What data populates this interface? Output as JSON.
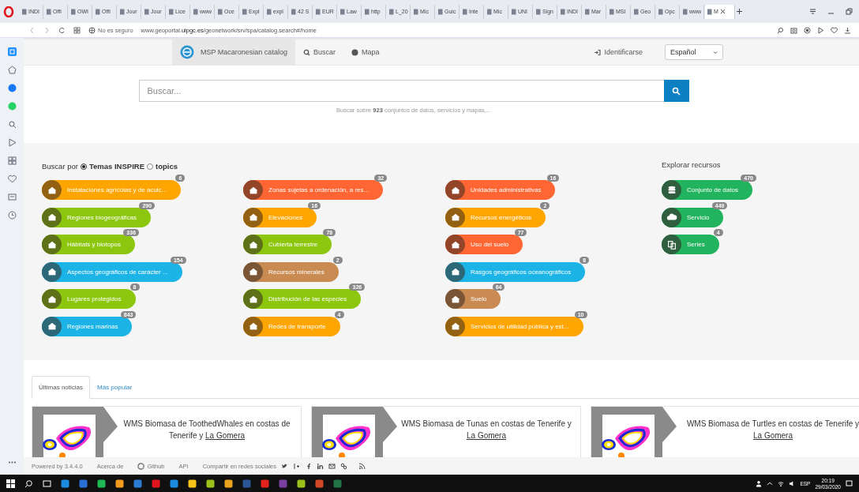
{
  "browser": {
    "tabs": [
      {
        "label": "INDI",
        "selected": false
      },
      {
        "label": "Offi",
        "selected": false
      },
      {
        "label": "OWI",
        "selected": false
      },
      {
        "label": "Offi",
        "selected": false
      },
      {
        "label": "Jour",
        "selected": false
      },
      {
        "label": "Jour",
        "selected": false
      },
      {
        "label": "Lice",
        "selected": false
      },
      {
        "label": "www",
        "selected": false
      },
      {
        "label": "Oce",
        "selected": false
      },
      {
        "label": "Expl",
        "selected": false
      },
      {
        "label": "expl",
        "selected": false
      },
      {
        "label": "42 S",
        "selected": false
      },
      {
        "label": "EUR",
        "selected": false
      },
      {
        "label": "Law",
        "selected": false
      },
      {
        "label": "http",
        "selected": false
      },
      {
        "label": "L_20",
        "selected": false
      },
      {
        "label": "Mic",
        "selected": false
      },
      {
        "label": "Guic",
        "selected": false
      },
      {
        "label": "Inte",
        "selected": false
      },
      {
        "label": "Mic",
        "selected": false
      },
      {
        "label": "UNI",
        "selected": false
      },
      {
        "label": "Sign",
        "selected": false
      },
      {
        "label": "INDI",
        "selected": false
      },
      {
        "label": "Mar",
        "selected": false
      },
      {
        "label": "MSI",
        "selected": false
      },
      {
        "label": "Geo",
        "selected": false
      },
      {
        "label": "Opc",
        "selected": false
      },
      {
        "label": "www",
        "selected": false
      },
      {
        "label": "M",
        "selected": true
      }
    ],
    "security": "No es seguro",
    "url": "www.geoportal.**ulpgc.es**/geonetwork/srv/spa/catalog.search#/home"
  },
  "nav": {
    "brand": "MSP Macaronesian catalog",
    "links": [
      "Buscar",
      "Mapa"
    ],
    "login": "Identificarse",
    "language": "Español"
  },
  "search": {
    "placeholder": "Buscar...",
    "hint": "Buscar sobre **923** conjuntos de datos, servicios y mapas,..."
  },
  "filter": {
    "label": "Buscar por",
    "options": [
      {
        "label": "Temas INSPIRE",
        "selected": true
      },
      {
        "label": "topics",
        "selected": false
      }
    ]
  },
  "themes": [
    {
      "label": "Instalaciones agrícolas y de acuic...",
      "count": "6",
      "color": "#ffa500"
    },
    {
      "label": "Regiones biogeográficas",
      "count": "290",
      "color": "#8cc70e"
    },
    {
      "label": "Hábitats y biotopos",
      "count": "336",
      "color": "#8cc70e"
    },
    {
      "label": "Aspectos geográficos de carácter ...",
      "count": "154",
      "color": "#1cb3e6"
    },
    {
      "label": "Lugares protegidos",
      "count": "8",
      "color": "#8cc70e"
    },
    {
      "label": "Regiones marinas",
      "count": "843",
      "color": "#1cb3e6"
    },
    {
      "label": "Zonas sujetas a ordenación, a res...",
      "count": "32",
      "color": "#ff6633"
    },
    {
      "label": "Elevaciones",
      "count": "16",
      "color": "#ffa500"
    },
    {
      "label": "Cubierta terrestre",
      "count": "78",
      "color": "#8cc70e"
    },
    {
      "label": "Recursos minerales",
      "count": "2",
      "color": "#c98b52"
    },
    {
      "label": "Distribución de las especies",
      "count": "326",
      "color": "#8cc70e"
    },
    {
      "label": "Redes de transporte",
      "count": "4",
      "color": "#ffa500"
    },
    {
      "label": "Unidades administrativas",
      "count": "16",
      "color": "#ff6633"
    },
    {
      "label": "Recursos energéticos",
      "count": "2",
      "color": "#ffa500"
    },
    {
      "label": "Uso del suelo",
      "count": "77",
      "color": "#ff6633"
    },
    {
      "label": "Rasgos geográficos oceanográficos",
      "count": "8",
      "color": "#1cb3e6"
    },
    {
      "label": "Suelo",
      "count": "64",
      "color": "#c98b52"
    },
    {
      "label": "Servicios de utilidad pública y est...",
      "count": "10",
      "color": "#ffa500"
    }
  ],
  "explore": {
    "title": "Explorar recursos",
    "items": [
      {
        "label": "Conjunto de datos",
        "count": "470"
      },
      {
        "label": "Servicio",
        "count": "449"
      },
      {
        "label": "Series",
        "count": "4"
      }
    ]
  },
  "news": {
    "tabs": [
      {
        "label": "Últimas noticias",
        "selected": true
      },
      {
        "label": "Más popular",
        "selected": false
      }
    ],
    "cards": [
      {
        "title": "WMS Biomasa de ToothedWhales en costas de Tenerife y",
        "link": "La Gomera"
      },
      {
        "title": "WMS Biomasa de Tunas en costas de Tenerife y",
        "link": "La Gomera"
      },
      {
        "title": "WMS Biomasa de Turtles en costas de Tenerife y",
        "link": "La Gomera"
      }
    ]
  },
  "footer": {
    "powered": "Powered by 3.4.4.0",
    "links": [
      "Acerca de",
      "Github",
      "API"
    ],
    "share": "Compartir en redes sociales"
  },
  "taskbar": {
    "language": "ESP",
    "time": "20:19",
    "date": "29/03/2020"
  }
}
